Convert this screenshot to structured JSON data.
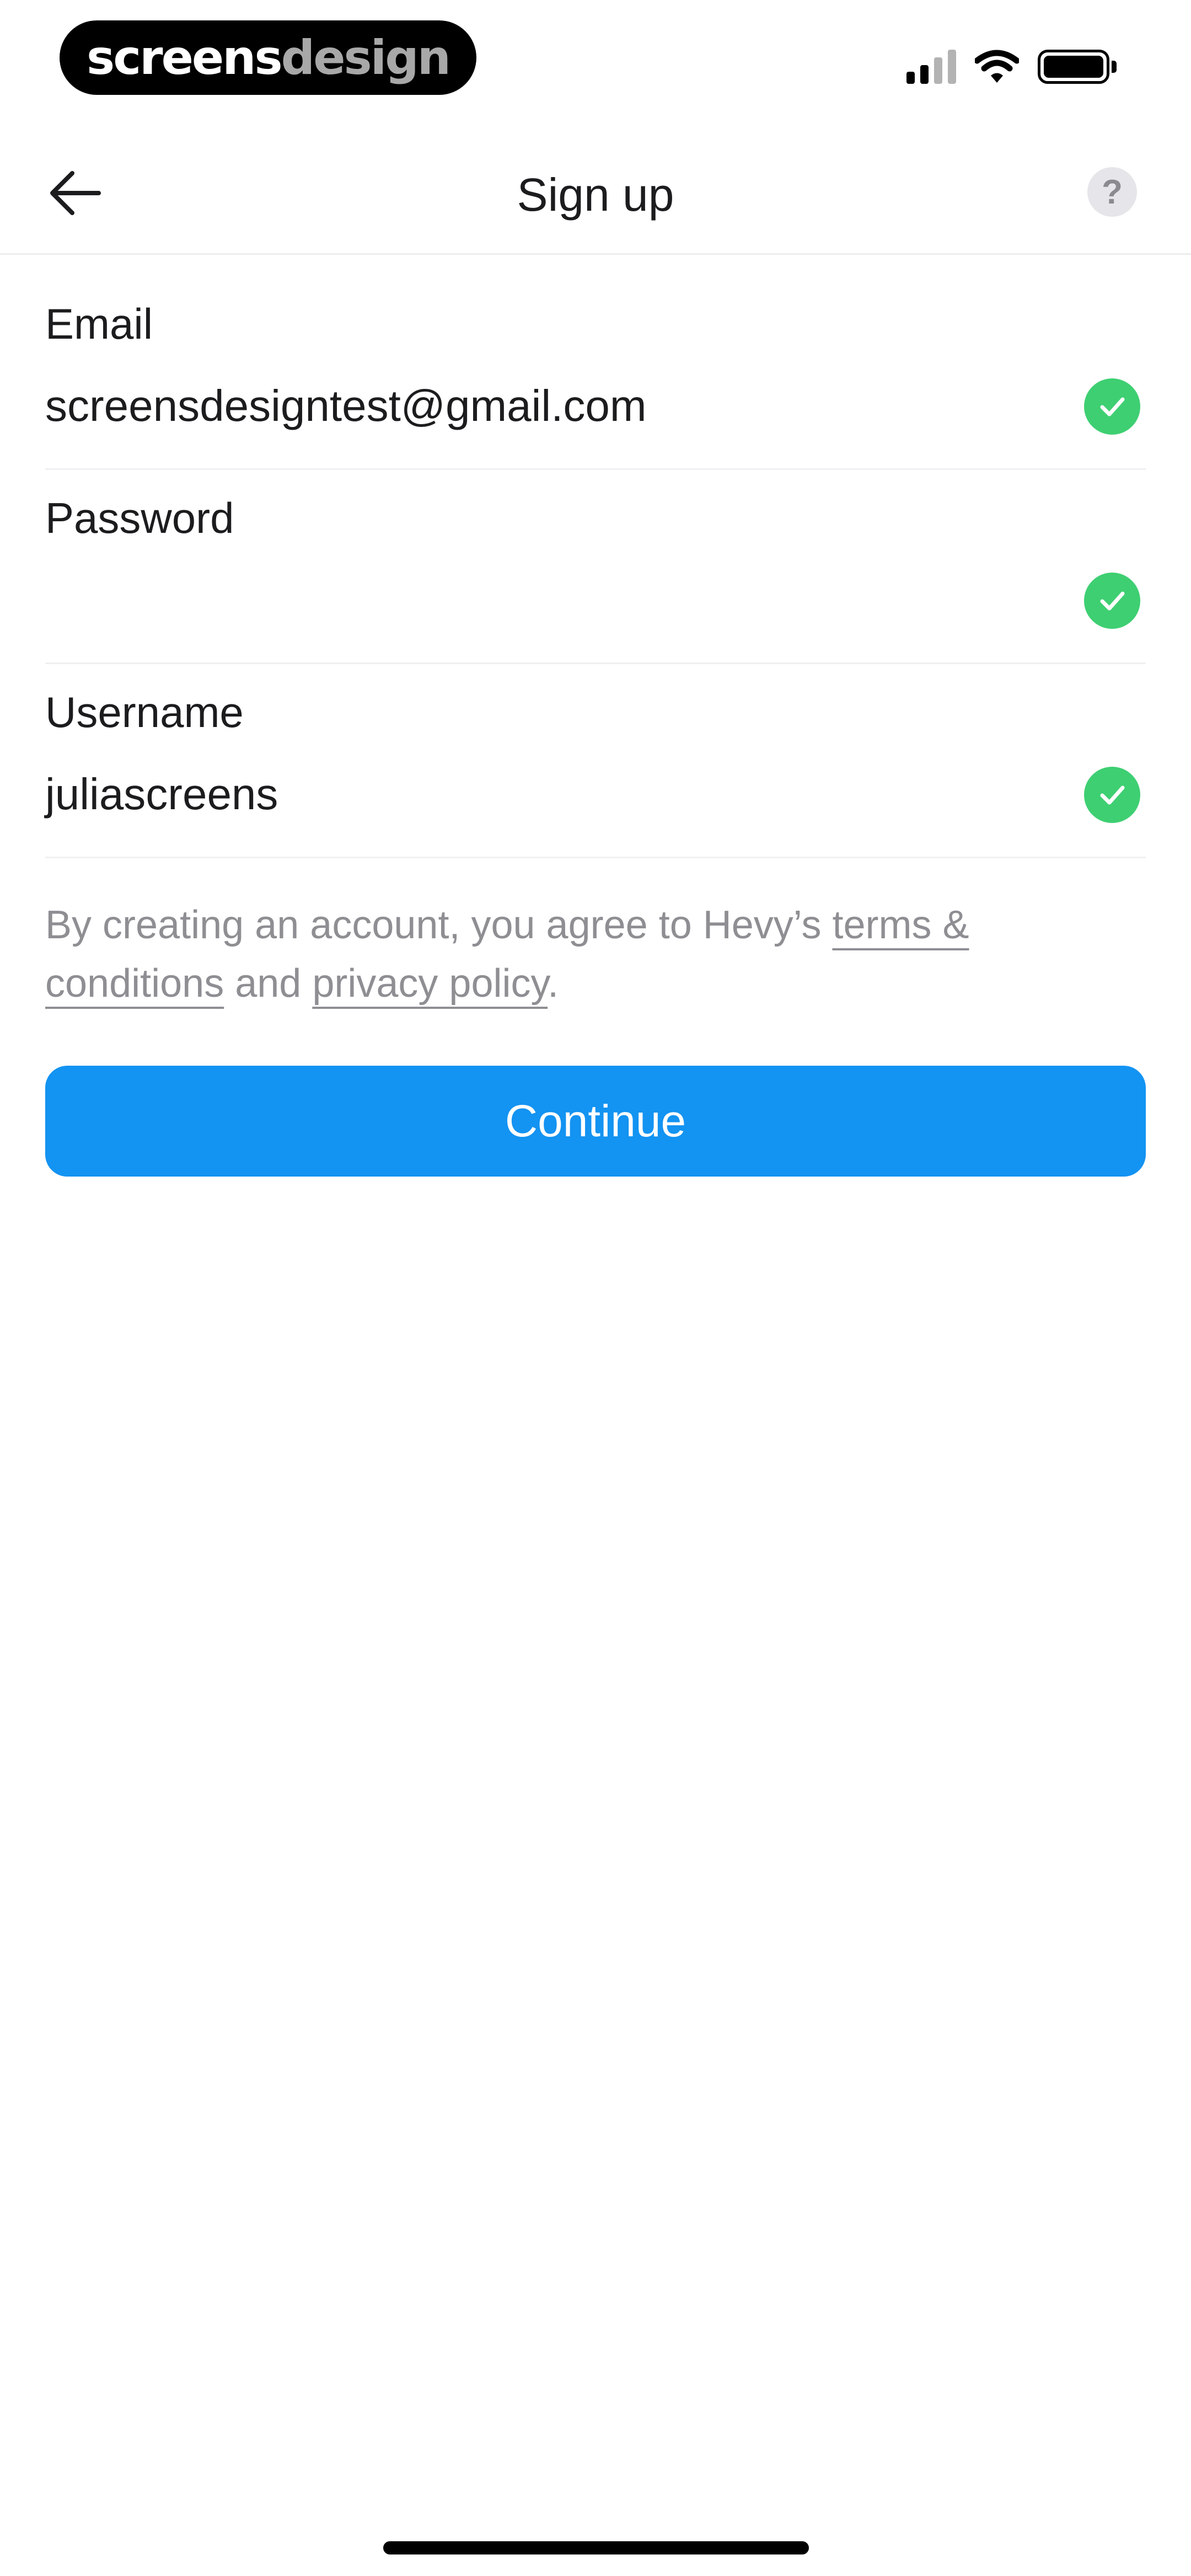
{
  "status_bar": {
    "brand_part1": "screens",
    "brand_part2": "design",
    "icons": [
      "signal-icon",
      "wifi-icon",
      "battery-icon"
    ]
  },
  "header": {
    "title": "Sign up",
    "back_icon": "arrow-left-icon",
    "help_icon": "question-icon",
    "help_label": "?"
  },
  "form": {
    "email": {
      "label": "Email",
      "value": "screensdesigntest@gmail.com",
      "valid": true
    },
    "password": {
      "label": "Password",
      "value": "",
      "valid": true
    },
    "username": {
      "label": "Username",
      "value": "juliascreens",
      "valid": true
    }
  },
  "terms": {
    "prefix": "By creating an account, you agree to Hevy’s ",
    "terms_link": "terms & conditions",
    "middle": " and ",
    "privacy_link": "privacy policy",
    "suffix": "."
  },
  "continue_label": "Continue",
  "colors": {
    "primary": "#1393f2",
    "success": "#3ecf72",
    "muted_text": "#8e8e93"
  }
}
